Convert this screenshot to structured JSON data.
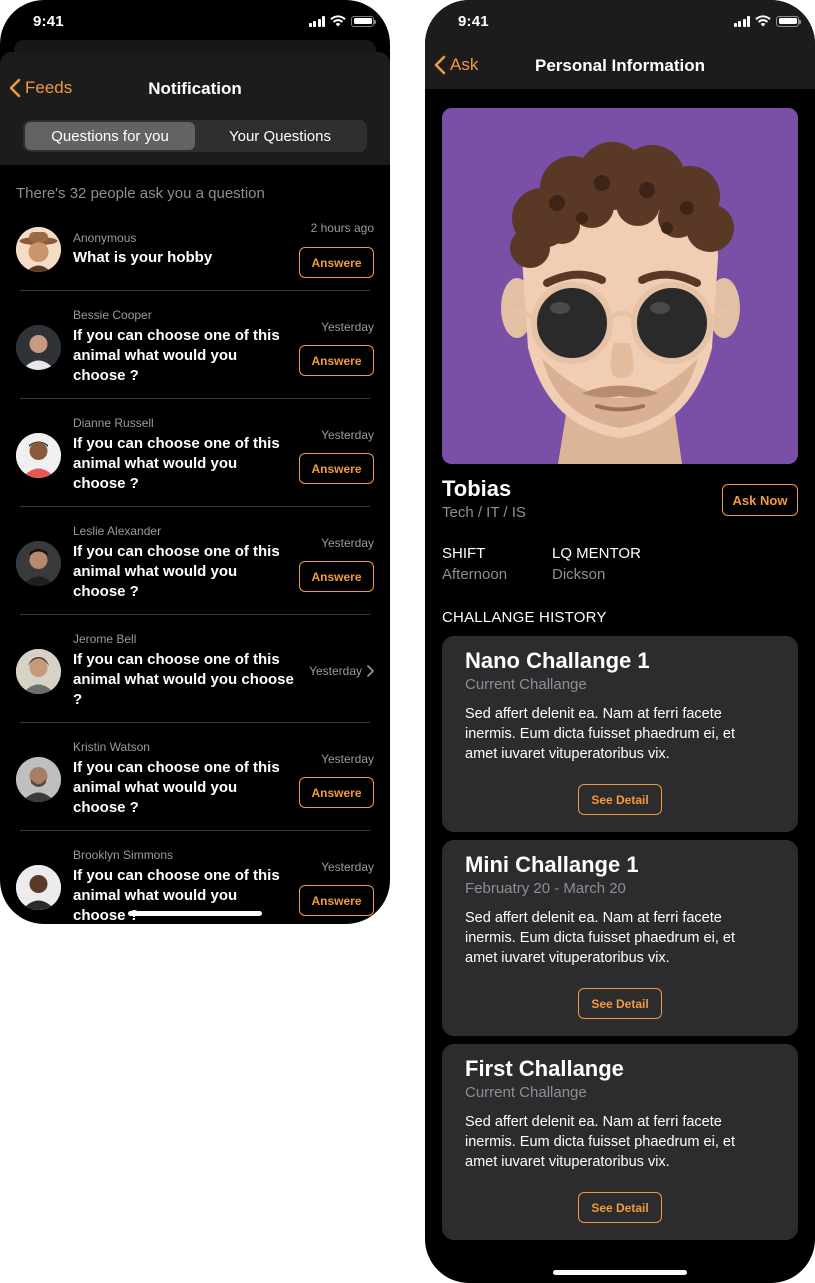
{
  "left_screen": {
    "status": {
      "time": "9:41"
    },
    "nav": {
      "back_label": "Feeds",
      "title": "Notification"
    },
    "segments": [
      {
        "label": "Questions for you",
        "active": true
      },
      {
        "label": "Your Questions",
        "active": false
      }
    ],
    "ask_count_text": "There's 32 people ask you a question",
    "questions": [
      {
        "name": "Anonymous",
        "question": "What is your hobby",
        "time": "2 hours ago",
        "action": "Answere",
        "avatar": "cowboy-hat-avatar"
      },
      {
        "name": "Bessie Cooper",
        "question": "If you can choose one of this animal what would you choose ?",
        "time": "Yesterday",
        "action": "Answere",
        "avatar": "photo-avatar"
      },
      {
        "name": "Dianne Russell",
        "question": "If you can choose one of this animal what would you choose ?",
        "time": "Yesterday",
        "action": "Answere",
        "avatar": "photo-avatar"
      },
      {
        "name": "Leslie Alexander",
        "question": "If you can choose one of this animal what would you choose ?",
        "time": "Yesterday",
        "action": "Answere",
        "avatar": "photo-avatar"
      },
      {
        "name": "Jerome Bell",
        "question": "If you can choose one of this animal what would you choose ?",
        "time": "Yesterday",
        "action": "",
        "avatar": "photo-avatar"
      },
      {
        "name": "Kristin Watson",
        "question": "If you can choose one of this animal what would you choose ?",
        "time": "Yesterday",
        "action": "Answere",
        "avatar": "photo-avatar"
      },
      {
        "name": "Brooklyn Simmons",
        "question": "If you can choose one of this animal what would you choose ?",
        "time": "Yesterday",
        "action": "Answere",
        "avatar": "photo-avatar"
      }
    ]
  },
  "right_screen": {
    "status": {
      "time": "9:41"
    },
    "nav": {
      "back_label": "Ask",
      "title": "Personal Information"
    },
    "profile": {
      "name": "Tobias",
      "department": "Tech / IT / IS",
      "ask_button": "Ask Now",
      "photo": "memoji-avatar"
    },
    "info": {
      "shift_label": "SHIFT",
      "shift_value": "Afternoon",
      "mentor_label": "LQ MENTOR",
      "mentor_value": "Dickson"
    },
    "history_title": "CHALLANGE HISTORY",
    "challenges": [
      {
        "title": "Nano Challange 1",
        "subtitle": "Current Challange",
        "body": "Sed affert delenit ea. Nam at ferri facete inermis. Eum dicta fuisset phaedrum ei, et amet iuvaret vituperatoribus vix.",
        "button": "See Detail"
      },
      {
        "title": "Mini Challange 1",
        "subtitle": "Februatry 20 - March 20",
        "body": "Sed affert delenit ea. Nam at ferri facete inermis. Eum dicta fuisset phaedrum ei, et amet iuvaret vituperatoribus vix.",
        "button": "See Detail"
      },
      {
        "title": "First Challange",
        "subtitle": "Current Challange",
        "body": "Sed affert delenit ea. Nam at ferri facete inermis. Eum dicta fuisset phaedrum ei, et amet iuvaret vituperatoribus vix.",
        "button": "See Detail"
      }
    ]
  },
  "colors": {
    "accent": "#f19a3e",
    "background": "#000000",
    "card": "#2c2c2e",
    "secondary_text": "#8e8e93",
    "profile_bg": "#7a4fa6"
  }
}
